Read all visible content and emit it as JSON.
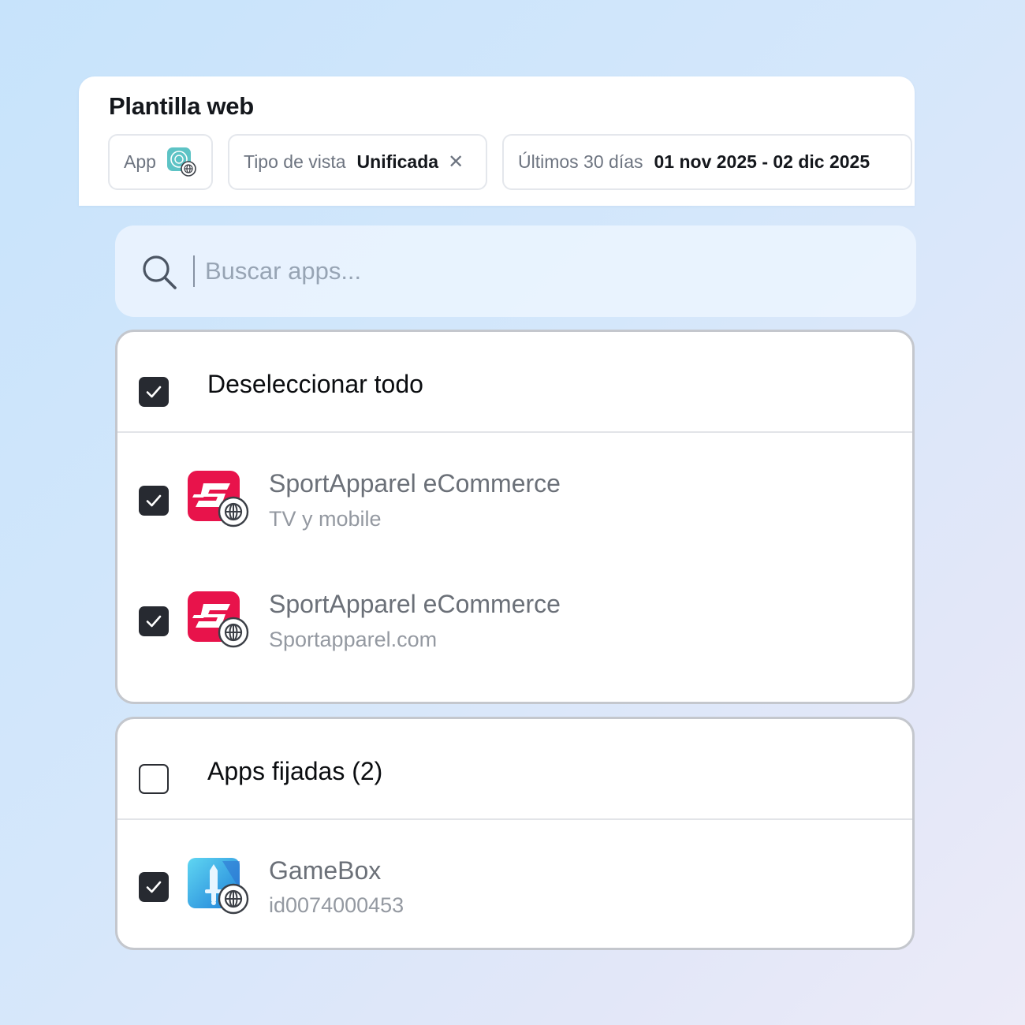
{
  "header": {
    "title": "Plantilla web",
    "app_chip_label": "App",
    "view_type_label": "Tipo de vista",
    "view_type_value": "Unificada",
    "date_range_label": "Últimos 30 días",
    "date_range_value": "01 nov 2025 - 02 dic 2025"
  },
  "search": {
    "placeholder": "Buscar apps..."
  },
  "groups": [
    {
      "label": "Deseleccionar todo",
      "checked": true,
      "apps": [
        {
          "name": "SportApparel eCommerce",
          "subtitle": "TV y mobile",
          "checked": true,
          "icon": "sportapparel-icon"
        },
        {
          "name": "SportApparel eCommerce",
          "subtitle": "Sportapparel.com",
          "checked": true,
          "icon": "sportapparel-icon"
        }
      ]
    },
    {
      "label": "Apps fijadas (2)",
      "checked": false,
      "apps": [
        {
          "name": "GameBox",
          "subtitle": "id0074000453",
          "checked": true,
          "icon": "gamebox-icon"
        }
      ]
    }
  ],
  "colors": {
    "checkbox_checked": "#272a31",
    "sportapparel_brand": "#e8134b",
    "gamebox_brand": "#3fb4ec",
    "app_chip_icon": "#5dc3c5"
  }
}
